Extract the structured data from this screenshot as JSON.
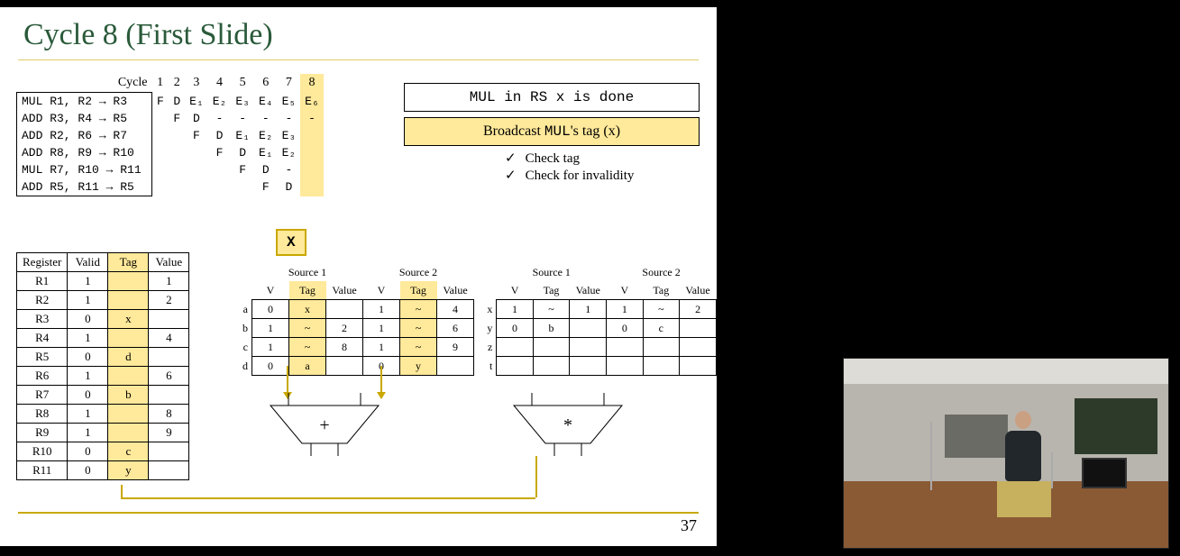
{
  "title": "Cycle 8 (First Slide)",
  "page_number": "37",
  "pipeline": {
    "header_label": "Cycle",
    "cycles": [
      "1",
      "2",
      "3",
      "4",
      "5",
      "6",
      "7",
      "8"
    ],
    "highlight_cycle": "8",
    "instructions": [
      {
        "text": "MUL  R1, R2  →  R3",
        "stages": [
          "F",
          "D",
          "E₁",
          "E₂",
          "E₃",
          "E₄",
          "E₅",
          "E₆"
        ]
      },
      {
        "text": "ADD  R3, R4  →  R5",
        "stages": [
          "",
          "F",
          "D",
          "-",
          "-",
          "-",
          "-",
          "-"
        ]
      },
      {
        "text": "ADD  R2, R6  →  R7",
        "stages": [
          "",
          "",
          "F",
          "D",
          "E₁",
          "E₂",
          "E₃",
          ""
        ]
      },
      {
        "text": "ADD  R8, R9  →  R10",
        "stages": [
          "",
          "",
          "",
          "F",
          "D",
          "E₁",
          "E₂",
          ""
        ]
      },
      {
        "text": "MUL  R7, R10 →  R11",
        "stages": [
          "",
          "",
          "",
          "",
          "F",
          "D",
          "-",
          ""
        ]
      },
      {
        "text": "ADD  R5, R11 →  R5",
        "stages": [
          "",
          "",
          "",
          "",
          "",
          "F",
          "D",
          ""
        ]
      }
    ]
  },
  "broadcast_tag": "X",
  "info": {
    "done": "MUL in RS x is done",
    "broadcast_prefix": "Broadcast ",
    "broadcast_mono": "MUL",
    "broadcast_suffix": "'s tag (x)",
    "checks": [
      "Check tag",
      "Check for invalidity"
    ]
  },
  "register_file": {
    "headers": [
      "Register",
      "Valid",
      "Tag",
      "Value"
    ],
    "rows": [
      {
        "r": "R1",
        "v": "1",
        "t": "",
        "val": "1"
      },
      {
        "r": "R2",
        "v": "1",
        "t": "",
        "val": "2"
      },
      {
        "r": "R3",
        "v": "0",
        "t": "x",
        "val": ""
      },
      {
        "r": "R4",
        "v": "1",
        "t": "",
        "val": "4"
      },
      {
        "r": "R5",
        "v": "0",
        "t": "d",
        "val": ""
      },
      {
        "r": "R6",
        "v": "1",
        "t": "",
        "val": "6"
      },
      {
        "r": "R7",
        "v": "0",
        "t": "b",
        "val": ""
      },
      {
        "r": "R8",
        "v": "1",
        "t": "",
        "val": "8"
      },
      {
        "r": "R9",
        "v": "1",
        "t": "",
        "val": "9"
      },
      {
        "r": "R10",
        "v": "0",
        "t": "c",
        "val": ""
      },
      {
        "r": "R11",
        "v": "0",
        "t": "y",
        "val": ""
      }
    ]
  },
  "rs_add": {
    "src1": "Source 1",
    "src2": "Source 2",
    "cols": [
      "V",
      "Tag",
      "Value",
      "V",
      "Tag",
      "Value"
    ],
    "rows": [
      {
        "l": "a",
        "c": [
          "0",
          "x",
          "",
          "1",
          "~",
          "4"
        ]
      },
      {
        "l": "b",
        "c": [
          "1",
          "~",
          "2",
          "1",
          "~",
          "6"
        ]
      },
      {
        "l": "c",
        "c": [
          "1",
          "~",
          "8",
          "1",
          "~",
          "9"
        ]
      },
      {
        "l": "d",
        "c": [
          "0",
          "a",
          "",
          "0",
          "y",
          ""
        ]
      }
    ],
    "op": "+"
  },
  "rs_mul": {
    "src1": "Source 1",
    "src2": "Source 2",
    "cols": [
      "V",
      "Tag",
      "Value",
      "V",
      "Tag",
      "Value"
    ],
    "rows": [
      {
        "l": "x",
        "c": [
          "1",
          "~",
          "1",
          "1",
          "~",
          "2"
        ]
      },
      {
        "l": "y",
        "c": [
          "0",
          "b",
          "",
          "0",
          "c",
          ""
        ]
      },
      {
        "l": "z",
        "c": [
          "",
          "",
          "",
          "",
          "",
          ""
        ]
      },
      {
        "l": "t",
        "c": [
          "",
          "",
          "",
          "",
          "",
          ""
        ]
      }
    ],
    "op": "*"
  }
}
